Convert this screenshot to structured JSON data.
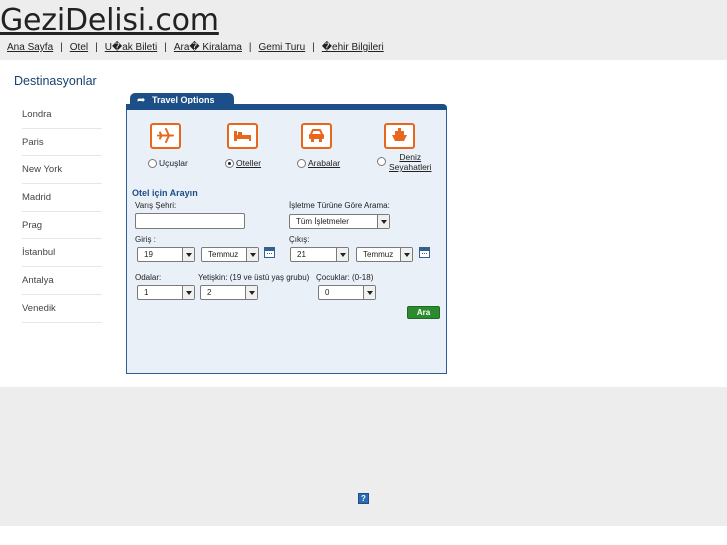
{
  "header": {
    "logo": "GeziDelisi.com",
    "nav": [
      "Ana Sayfa",
      "Otel",
      "U�ak Bileti",
      "Ara� Kiralama",
      "Gemi Turu",
      "�ehir Bilgileri"
    ],
    "separator": "|"
  },
  "sidebar": {
    "title": "Destinasyonlar",
    "items": [
      "Londra",
      "Paris",
      "New York",
      "Madrid",
      "Prag",
      "İstanbul",
      "Antalya",
      "Venedik"
    ]
  },
  "panel": {
    "tab_label": "Travel Options",
    "options": [
      {
        "icon": "plane-icon",
        "label": "Uçuşlar",
        "selected": false
      },
      {
        "icon": "bed-icon",
        "label": "Oteller",
        "selected": true
      },
      {
        "icon": "car-icon",
        "label": "Arabalar",
        "selected": false
      },
      {
        "icon": "ship-icon",
        "label_line1": "Deniz",
        "label_line2": "Seyahatleri",
        "selected": false
      }
    ],
    "form": {
      "title": "Otel için Arayın",
      "destination_label": "Varış Şehri:",
      "destination_value": "",
      "business_type_label": "İşletme Türüne Göre Arama:",
      "business_type_value": "Tüm İşletmeler",
      "checkin_label": "Giriş :",
      "checkin_day": "19",
      "checkin_month": "Temmuz",
      "checkout_label": "Çıkış:",
      "checkout_day": "21",
      "checkout_month": "Temmuz",
      "rooms_label": "Odalar:",
      "rooms_value": "1",
      "adults_label": "Yetişkin: (19 ve üstü yaş grubu)",
      "adults_value": "2",
      "children_label": "Çocuklar: (0-18)",
      "children_value": "0",
      "search_button": "Ara"
    }
  },
  "footer": {
    "icon": "broken-image-icon",
    "icon_glyph": "?"
  },
  "colors": {
    "brand_blue": "#1c4f87",
    "accent_orange": "#e8671d",
    "button_green": "#2e8a2e",
    "band_gray": "#ededed"
  }
}
